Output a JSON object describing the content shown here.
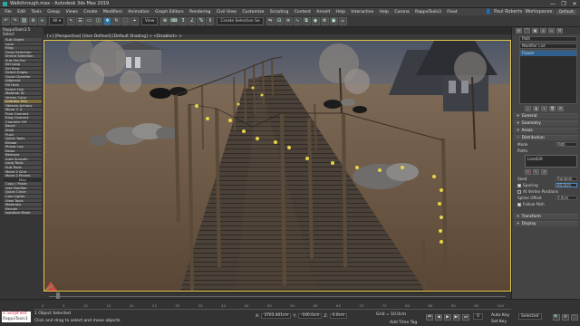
{
  "window": {
    "title": "Walkthrough.max - Autodesk 3ds Max 2019",
    "controls": [
      "—",
      "❐",
      "✕"
    ]
  },
  "menubar": {
    "items": [
      "File",
      "Edit",
      "Tools",
      "Group",
      "Views",
      "Create",
      "Modifiers",
      "Animation",
      "Graph Editors",
      "Rendering",
      "Civil View",
      "Customize",
      "Scripting",
      "Content",
      "Arnold",
      "Help",
      "Interactive",
      "Help",
      "Corona",
      "RappaTools3",
      "Float"
    ],
    "user": "Paul Roberts",
    "workspace_label": "Workspaces:",
    "workspace": "Default"
  },
  "toolbar": {
    "selection_set": "Create Selection Se",
    "view_dropdown": "View"
  },
  "ribbon": {
    "title": "RappaTools3.5",
    "subtitle": "Select"
  },
  "left_panel": {
    "items": [
      "Sub Object",
      "Loop",
      "Ring",
      "Grow Selection",
      "Shrink Selection",
      "Sub Obj.Sel",
      "Sel Loop",
      "Sel Ring",
      "Select Edges",
      "Quad Chamfer",
      "Adjacent",
      "Fill Hole",
      "Select Hull",
      "Material ID",
      "Vertex Color",
      "Editable Poly",
      "Objects Actions",
      "Move  ↕ X",
      "Flow Connect",
      "Ring Connect",
      "Chamfer Off",
      "Bevel",
      "Slide",
      "Push",
      "Quick Tools",
      "Bridge",
      "Planar Lay",
      "Relax",
      "Remove",
      "Auto Smooth",
      "Loop Tools",
      "Sub Tools",
      "Move 2 Grid",
      "Move 2 Planes"
    ],
    "section_label": "Misc",
    "misc_items": [
      "Copy / Paste",
      "Add Modifier",
      "Quick Circle",
      "Cam Lights",
      "View Tools",
      "Materials",
      "Render"
    ],
    "footer": "Isolation Mode"
  },
  "viewport": {
    "label": "[+] [Perspective] [User Defined] [Default Shading]  < <Disabled> >"
  },
  "right_panel": {
    "tabs": [
      "+",
      "⌒",
      "▣",
      "◎",
      "▭",
      "⚒"
    ],
    "object_name": "Path",
    "modifier_list_label": "Modifier List",
    "stack": [
      "Flower"
    ],
    "sections": [
      "General",
      "Geometry",
      "Areas"
    ],
    "distribution": {
      "title": "Distribution",
      "mode_label": "Mode",
      "mode_value": "Path",
      "paths_label": "Paths",
      "path_item": "Line029",
      "spacing_label": "Spacing",
      "spacing_value": "60.0cm",
      "vertex_label": "At Vertex Positions",
      "offset_label": "Spline Offset",
      "offset_value": "0.0cm",
      "follow_label": "Follow Path",
      "seed_label": "Seed",
      "seed_value": "Random"
    },
    "footer_sections": [
      "Transform",
      "Display"
    ]
  },
  "status": {
    "ruler": [
      "0",
      "5",
      "10",
      "15",
      "20",
      "25",
      "30",
      "35",
      "40",
      "45",
      "50",
      "55",
      "60",
      "65",
      "70",
      "75",
      "80",
      "85",
      "90",
      "95",
      "100"
    ],
    "maxscript_1": "s:.ScriptTest",
    "maxscript_2": "RappaTools3",
    "selected": "1 Object Selected",
    "prompt": "Click and drag to select and move objects",
    "x_label": "X:",
    "x_value": "3703.401cm",
    "y_label": "Y:",
    "y_value": "-100.0cm",
    "z_label": "Z:",
    "z_value": "0.0cm",
    "grid": "Grid = 10.0cm",
    "time_tag": "Add Time Tag",
    "auto_key": "Auto Key",
    "set_key": "Set Key",
    "selected_dropdown": "Selected",
    "frame": "0"
  }
}
